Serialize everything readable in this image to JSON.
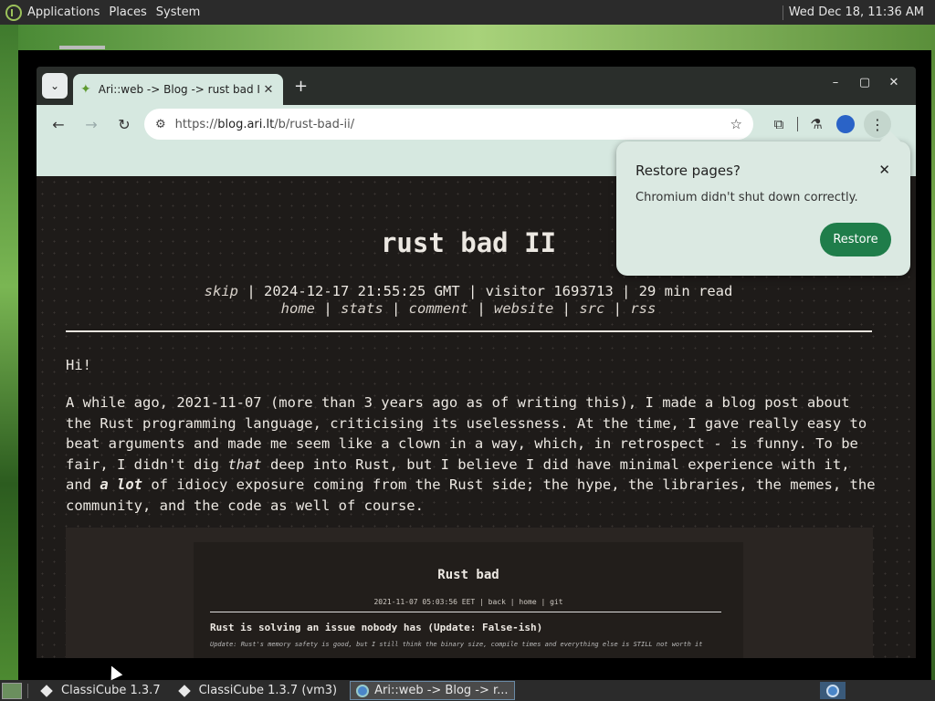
{
  "top_panel": {
    "menus": [
      "Applications",
      "Places",
      "System"
    ],
    "clock": "Wed Dec 18, 11:36 AM"
  },
  "browser": {
    "tab": {
      "title": "Ari::web -> Blog -> rust bad II",
      "close_icon": "close-icon"
    },
    "new_tab_label": "+",
    "window_controls": {
      "minimize": "–",
      "maximize": "▢",
      "close": "✕"
    },
    "url": {
      "scheme": "https://",
      "host": "blog.ari.lt",
      "path": "/b/rust-bad-ii/"
    }
  },
  "restore_bubble": {
    "title": "Restore pages?",
    "message": "Chromium didn't shut down correctly.",
    "button": "Restore"
  },
  "page": {
    "title": "rust bad II",
    "meta": {
      "skip": "skip",
      "datetime": "2024-12-17 21:55:25",
      "tz": "GMT",
      "visitor_label": "visitor",
      "visitor_count": "1693713",
      "read_time": "29 min",
      "read_label": "read"
    },
    "links": [
      "home",
      "stats",
      "comment",
      "website",
      "src",
      "rss"
    ],
    "greeting": "Hi!",
    "paragraph": {
      "part1": "A while ago, 2021-11-07 (more than 3 years ago as of writing this), I made a blog post about the Rust programming language, criticising its uselessness. At the time, I gave really easy to beat arguments and made me seem like a clown in a way, which, in retrospect - is funny. To be fair, I didn't dig ",
      "em1": "that",
      "part2": " deep into Rust, but I believe I did have minimal experience with it, and ",
      "em2": "a lot",
      "part3": " of idiocy exposure coming from the Rust side; the hype, the libraries, the memes, the community, and the code as well of course."
    },
    "embed": {
      "title": "Rust bad",
      "meta": "2021-11-07 05:03:56 EET | back | home | git",
      "heading": "Rust is solving an issue nobody has (Update: False-ish)",
      "note": "Update: Rust's memory safety is good, but I still think the binary size, compile times and everything else is STILL not worth it"
    }
  },
  "taskbar": {
    "tasks": [
      "ClassiCube 1.3.7",
      "ClassiCube 1.3.7 (vm3)",
      "Ari::web -> Blog -> r..."
    ]
  }
}
